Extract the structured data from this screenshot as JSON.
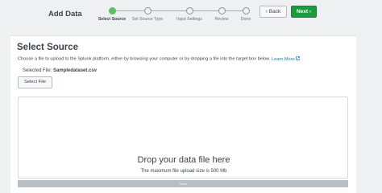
{
  "header": {
    "title": "Add Data",
    "back_label": "Back",
    "back_icon": "chevron-left-icon",
    "next_label": "Next",
    "next_icon": "chevron-right-icon",
    "next_color": "#1a9c3e"
  },
  "wizard": {
    "steps": [
      {
        "label": "Select Source",
        "active": true
      },
      {
        "label": "Set Source Type",
        "active": false
      },
      {
        "label": "Input Settings",
        "active": false
      },
      {
        "label": "Review",
        "active": false
      },
      {
        "label": "Done",
        "active": false
      }
    ],
    "active_color": "#5cc05c"
  },
  "main": {
    "title": "Select Source",
    "description": "Choose a file to upload to the Splunk platform, either by browsing your computer or by dropping a file into the target box below.",
    "learn_more": "Learn More",
    "selected_file_label": "Selected File:",
    "selected_file_name": "Sampledataset.csv",
    "select_file_button": "Select File",
    "drop_title": "Drop your data file here",
    "drop_limit": "The maximum file upload size is 500 Mb",
    "progress": {
      "label": "Done",
      "fraction": 1.0
    }
  }
}
